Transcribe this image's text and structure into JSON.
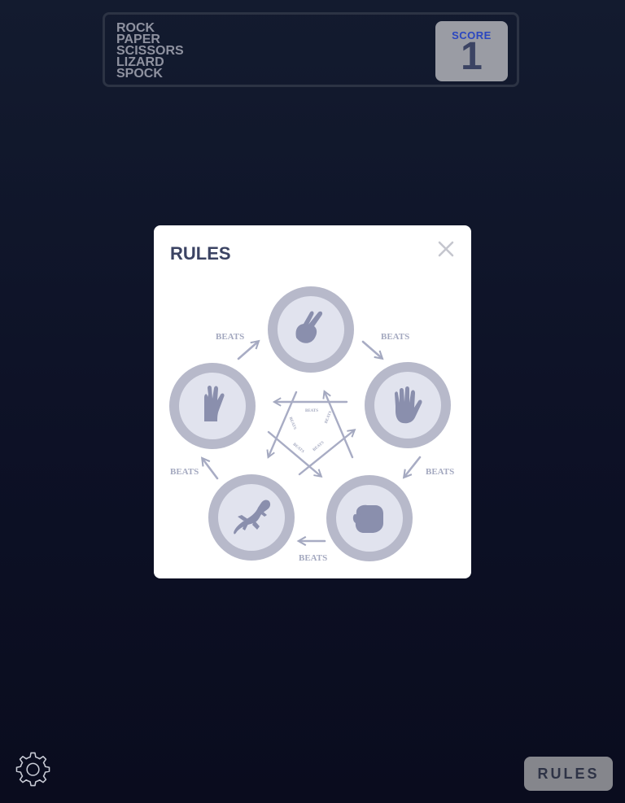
{
  "header": {
    "title_lines": [
      "ROCK",
      "PAPER",
      "SCISSORS",
      "LIZARD",
      "SPOCK"
    ],
    "score_label": "SCORE",
    "score_value": "1"
  },
  "modal": {
    "title": "RULES",
    "beats_label": "BEATS",
    "moves": [
      {
        "name": "scissors",
        "icon": "scissors-hand-icon"
      },
      {
        "name": "paper",
        "icon": "paper-hand-icon"
      },
      {
        "name": "rock",
        "icon": "rock-fist-icon"
      },
      {
        "name": "lizard",
        "icon": "lizard-icon"
      },
      {
        "name": "spock",
        "icon": "spock-hand-icon"
      }
    ]
  },
  "footer": {
    "rules_button_label": "RULES",
    "settings_icon": "gear-icon"
  },
  "colors": {
    "score_label": "#2a46c0",
    "dark_text": "#3b4363",
    "icon_fill": "#8a8fad",
    "ring_outer": "#b7b9ca",
    "ring_inner": "#e1e3ee"
  }
}
